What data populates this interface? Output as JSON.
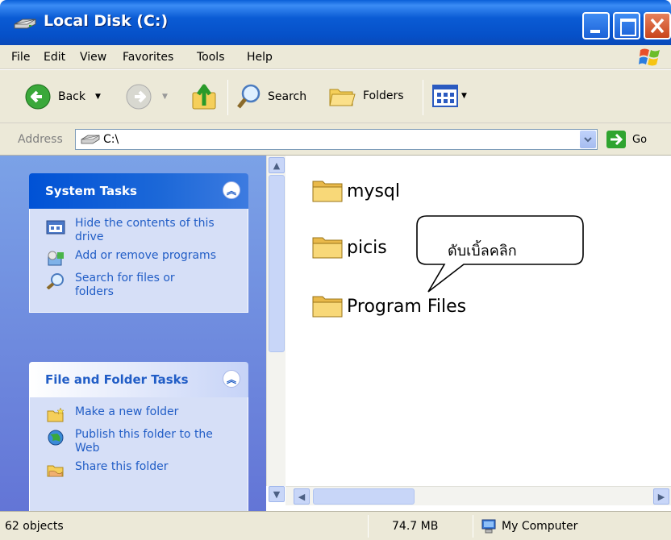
{
  "window": {
    "title": "Local Disk (C:)"
  },
  "menu": {
    "items": [
      "File",
      "Edit",
      "View",
      "Favorites",
      "Tools",
      "Help"
    ]
  },
  "toolbar": {
    "back_label": "Back",
    "search_label": "Search",
    "folders_label": "Folders"
  },
  "address": {
    "label": "Address",
    "value": "C:\\",
    "go_label": "Go"
  },
  "system_tasks": {
    "title": "System Tasks",
    "items": [
      {
        "label": "Hide the contents of this drive",
        "icon": "hide-drive-icon"
      },
      {
        "label": "Add or remove programs",
        "icon": "add-remove-programs-icon"
      },
      {
        "label": "Search for files or folders",
        "icon": "search-icon"
      }
    ]
  },
  "file_folder_tasks": {
    "title": "File and Folder Tasks",
    "items": [
      {
        "label": "Make a new folder",
        "icon": "new-folder-icon"
      },
      {
        "label": "Publish this folder to the Web",
        "icon": "publish-web-icon"
      },
      {
        "label": "Share this folder",
        "icon": "share-folder-icon"
      }
    ]
  },
  "files": [
    {
      "name": "mysql",
      "icon": "folder-icon"
    },
    {
      "name": "picis",
      "icon": "folder-icon"
    },
    {
      "name": "Program Files",
      "icon": "folder-icon"
    }
  ],
  "callout": {
    "text": "ดับเบิ้ลคลิก"
  },
  "status": {
    "objects": "62 objects",
    "size": "74.7 MB",
    "location": "My Computer"
  },
  "colors": {
    "titlebar": "#0a5bd4",
    "taskpane": "#7ba2e7",
    "link": "#215dc6",
    "chrome": "#ece9d8"
  }
}
